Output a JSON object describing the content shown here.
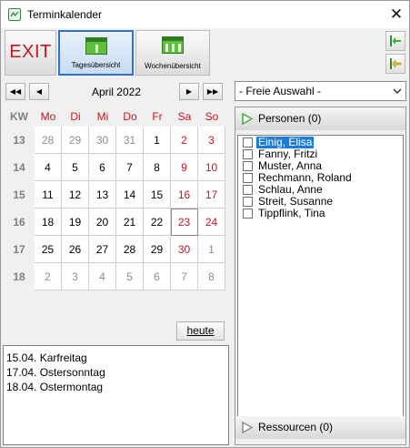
{
  "window": {
    "title": "Terminkalender"
  },
  "toolbar": {
    "exit_label": "EXIT",
    "day_view_label": "Tagesübersicht",
    "week_view_label": "Wochenübersicht"
  },
  "calendar": {
    "month_label": "April 2022",
    "kw_header": "KW",
    "day_headers": [
      "Mo",
      "Di",
      "Mi",
      "Do",
      "Fr",
      "Sa",
      "So"
    ],
    "weeks": [
      {
        "kw": "13",
        "days": [
          "28",
          "29",
          "30",
          "31",
          "1",
          "2",
          "3"
        ]
      },
      {
        "kw": "14",
        "days": [
          "4",
          "5",
          "6",
          "7",
          "8",
          "9",
          "10"
        ]
      },
      {
        "kw": "15",
        "days": [
          "11",
          "12",
          "13",
          "14",
          "15",
          "16",
          "17"
        ]
      },
      {
        "kw": "16",
        "days": [
          "18",
          "19",
          "20",
          "21",
          "22",
          "23",
          "24"
        ]
      },
      {
        "kw": "17",
        "days": [
          "25",
          "26",
          "27",
          "28",
          "29",
          "30",
          "1"
        ]
      },
      {
        "kw": "18",
        "days": [
          "2",
          "3",
          "4",
          "5",
          "6",
          "7",
          "8"
        ]
      }
    ],
    "today_button": "heute"
  },
  "holidays": [
    "15.04. Karfreitag",
    "17.04. Ostersonntag",
    "18.04. Ostermontag"
  ],
  "filter": {
    "selected": "- Freie Auswahl -"
  },
  "persons": {
    "header": "Personen (0)",
    "items": [
      {
        "name": "Einig, Elisa",
        "selected": true
      },
      {
        "name": "Fanny, Fritzi",
        "selected": false
      },
      {
        "name": "Muster, Anna",
        "selected": false
      },
      {
        "name": "Rechmann, Roland",
        "selected": false
      },
      {
        "name": "Schlau, Anne",
        "selected": false
      },
      {
        "name": "Streit, Susanne",
        "selected": false
      },
      {
        "name": "Tippflink, Tina",
        "selected": false
      }
    ]
  },
  "resources": {
    "header": "Ressourcen (0)"
  },
  "colors": {
    "accent": "#2f73c8",
    "weekend": "#c8141e",
    "selection": "#1f7bd8",
    "icon_green": "#5fbf3c"
  }
}
